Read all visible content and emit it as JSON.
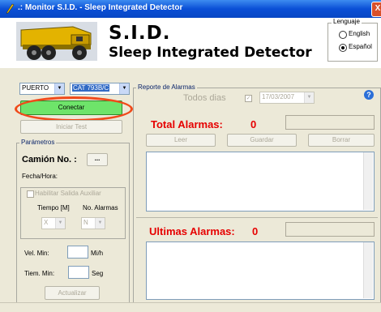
{
  "window": {
    "title": ".: Monitor S.I.D. - Sleep Integrated Detector",
    "close_glyph": "X"
  },
  "header": {
    "title": "S.I.D.",
    "subtitle": "Sleep Integrated Detector"
  },
  "language": {
    "legend": "Lenguaje",
    "options": [
      "English",
      "Español"
    ],
    "selected": "Español"
  },
  "connection": {
    "port": "PUERTO",
    "device": "CAT 793B/C",
    "connect_label": "Conectar",
    "start_test_label": "Iniciar Test"
  },
  "parameters": {
    "legend": "Parámetros",
    "truck_label": "Camión No. :",
    "truck_button": "...",
    "datetime_label": "Fecha/Hora:",
    "aux_output_label": "Habilitar Salida Auxiliar",
    "time_label": "Tiempo [M]",
    "alarms_count_label": "No. Alarmas",
    "time_value": "X",
    "alarms_value": "N",
    "vel_min_label": "Vel. Min:",
    "vel_unit": "Mi/h",
    "tiem_min_label": "Tiem. Min:",
    "tiem_unit": "Seg",
    "update_label": "Actualizar"
  },
  "report": {
    "legend": "Reporte de Alarmas",
    "all_days_label": "Todos dias",
    "date_value": "17/03/2007",
    "total_label": "Total Alarmas:",
    "total_value": "0",
    "read_label": "Leer",
    "save_label": "Guardar",
    "delete_label": "Borrar",
    "last_label": "Ultimas Alarmas:",
    "last_value": "0"
  },
  "colors": {
    "accent_red": "#e60000",
    "connect_green": "#6ee46a",
    "highlight_oval": "#f04a1a",
    "titlebar_blue": "#0a4fd6"
  }
}
